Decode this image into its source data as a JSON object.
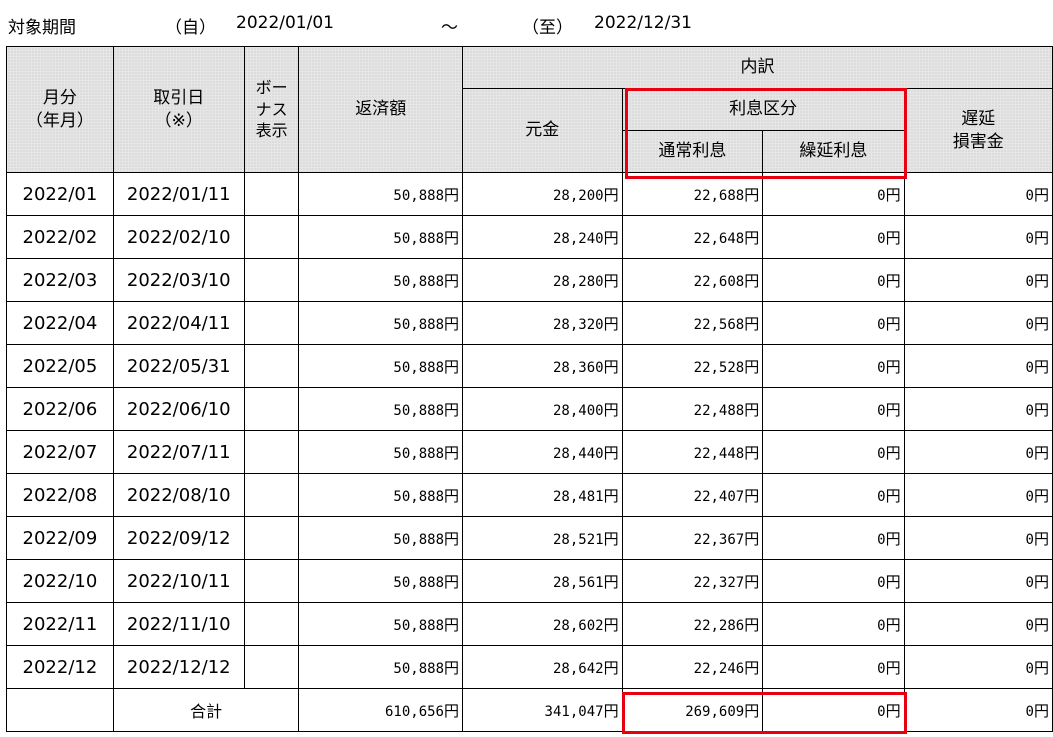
{
  "period": {
    "label": "対象期間",
    "from_label": "（自）",
    "from": "2022/01/01",
    "tilde": "～",
    "to_label": "（至）",
    "to": "2022/12/31"
  },
  "headers": {
    "month_line1": "月分",
    "month_line2": "（年月）",
    "date_line1": "取引日",
    "date_line2": "（※）",
    "bonus_line1": "ボー",
    "bonus_line2": "ナス",
    "bonus_line3": "表示",
    "repayment": "返済額",
    "breakdown": "内訳",
    "principal": "元金",
    "interest_category": "利息区分",
    "normal_interest": "通常利息",
    "deferred_interest": "繰延利息",
    "late_line1": "遅延",
    "late_line2": "損害金"
  },
  "currency_unit": "円",
  "rows": [
    {
      "month": "2022/01",
      "date": "2022/01/11",
      "bonus": "",
      "repayment": "50,888",
      "principal": "28,200",
      "normal": "22,688",
      "deferred": "0",
      "late": "0"
    },
    {
      "month": "2022/02",
      "date": "2022/02/10",
      "bonus": "",
      "repayment": "50,888",
      "principal": "28,240",
      "normal": "22,648",
      "deferred": "0",
      "late": "0"
    },
    {
      "month": "2022/03",
      "date": "2022/03/10",
      "bonus": "",
      "repayment": "50,888",
      "principal": "28,280",
      "normal": "22,608",
      "deferred": "0",
      "late": "0"
    },
    {
      "month": "2022/04",
      "date": "2022/04/11",
      "bonus": "",
      "repayment": "50,888",
      "principal": "28,320",
      "normal": "22,568",
      "deferred": "0",
      "late": "0"
    },
    {
      "month": "2022/05",
      "date": "2022/05/31",
      "bonus": "",
      "repayment": "50,888",
      "principal": "28,360",
      "normal": "22,528",
      "deferred": "0",
      "late": "0"
    },
    {
      "month": "2022/06",
      "date": "2022/06/10",
      "bonus": "",
      "repayment": "50,888",
      "principal": "28,400",
      "normal": "22,488",
      "deferred": "0",
      "late": "0"
    },
    {
      "month": "2022/07",
      "date": "2022/07/11",
      "bonus": "",
      "repayment": "50,888",
      "principal": "28,440",
      "normal": "22,448",
      "deferred": "0",
      "late": "0"
    },
    {
      "month": "2022/08",
      "date": "2022/08/10",
      "bonus": "",
      "repayment": "50,888",
      "principal": "28,481",
      "normal": "22,407",
      "deferred": "0",
      "late": "0"
    },
    {
      "month": "2022/09",
      "date": "2022/09/12",
      "bonus": "",
      "repayment": "50,888",
      "principal": "28,521",
      "normal": "22,367",
      "deferred": "0",
      "late": "0"
    },
    {
      "month": "2022/10",
      "date": "2022/10/11",
      "bonus": "",
      "repayment": "50,888",
      "principal": "28,561",
      "normal": "22,327",
      "deferred": "0",
      "late": "0"
    },
    {
      "month": "2022/11",
      "date": "2022/11/10",
      "bonus": "",
      "repayment": "50,888",
      "principal": "28,602",
      "normal": "22,286",
      "deferred": "0",
      "late": "0"
    },
    {
      "month": "2022/12",
      "date": "2022/12/12",
      "bonus": "",
      "repayment": "50,888",
      "principal": "28,642",
      "normal": "22,246",
      "deferred": "0",
      "late": "0"
    }
  ],
  "total": {
    "label": "合計",
    "repayment": "610,656",
    "principal": "341,047",
    "normal": "269,609",
    "deferred": "0",
    "late": "0"
  },
  "colors": {
    "highlight": "#e60012",
    "header_bg": "#e6e6e6"
  }
}
